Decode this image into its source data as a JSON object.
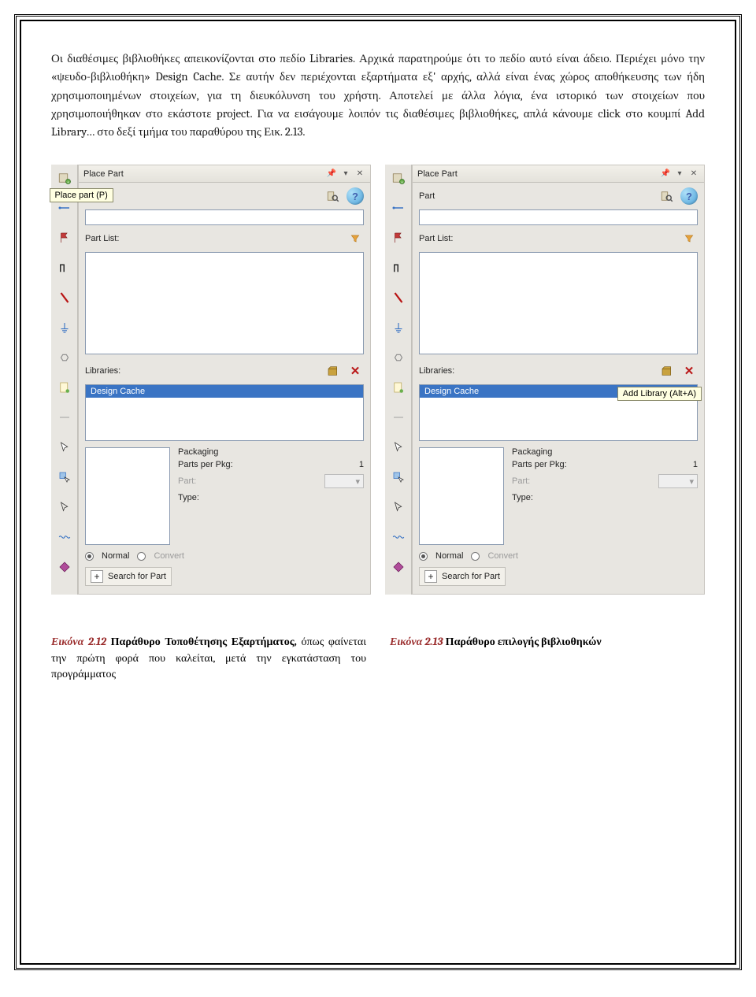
{
  "paragraph": "Οι διαθέσιμες βιβλιοθήκες απεικονίζονται στο πεδίο Libraries. Αρχικά παρατηρούμε ότι το πεδίο αυτό είναι άδειο. Περιέχει μόνο την «ψευδο-βιβλιοθήκη» Design Cache. Σε αυτήν δεν περιέχονται εξαρτήματα εξ' αρχής, αλλά είναι ένας χώρος αποθήκευσης των ήδη χρησιμοποιημένων στοιχείων, για τη διευκόλυνση του χρήστη. Αποτελεί με άλλα λόγια, ένα ιστορικό των στοιχείων που χρησιμοποιήθηκαν στο εκάστοτε project. Για να εισάγουμε λοιπόν τις διαθέσιμες βιβλιοθήκες, απλά κάνουμε click στο κουμπί Add Library… στο δεξί τμήμα του παραθύρου της Εικ. 2.13.",
  "panel": {
    "title": "Place Part",
    "part_label": "Part",
    "partlist_label": "Part List:",
    "libraries_label": "Libraries:",
    "design_cache": "Design Cache",
    "packaging_label": "Packaging",
    "parts_per_pkg_label": "Parts per Pkg:",
    "parts_per_pkg_value": "1",
    "part_dropdown_label": "Part:",
    "type_label": "Type:",
    "normal_label": "Normal",
    "convert_label": "Convert",
    "search_for_part": "Search for Part"
  },
  "tooltips": {
    "place_part": "Place part (P)",
    "add_library": "Add Library (Alt+A)"
  },
  "captions": {
    "left_label": "Εικόνα 2.12",
    "left_title": " Παράθυρο Τοποθέτησης Εξαρτήματος,",
    "left_rest": " όπως φαίνεται την πρώτη φορά που καλείται, μετά την εγκατάσταση του προγράμματος",
    "right_label": "Εικόνα 2.13",
    "right_title": " Παράθυρο επιλογής βιβλιοθηκών",
    "right_rest": ""
  }
}
